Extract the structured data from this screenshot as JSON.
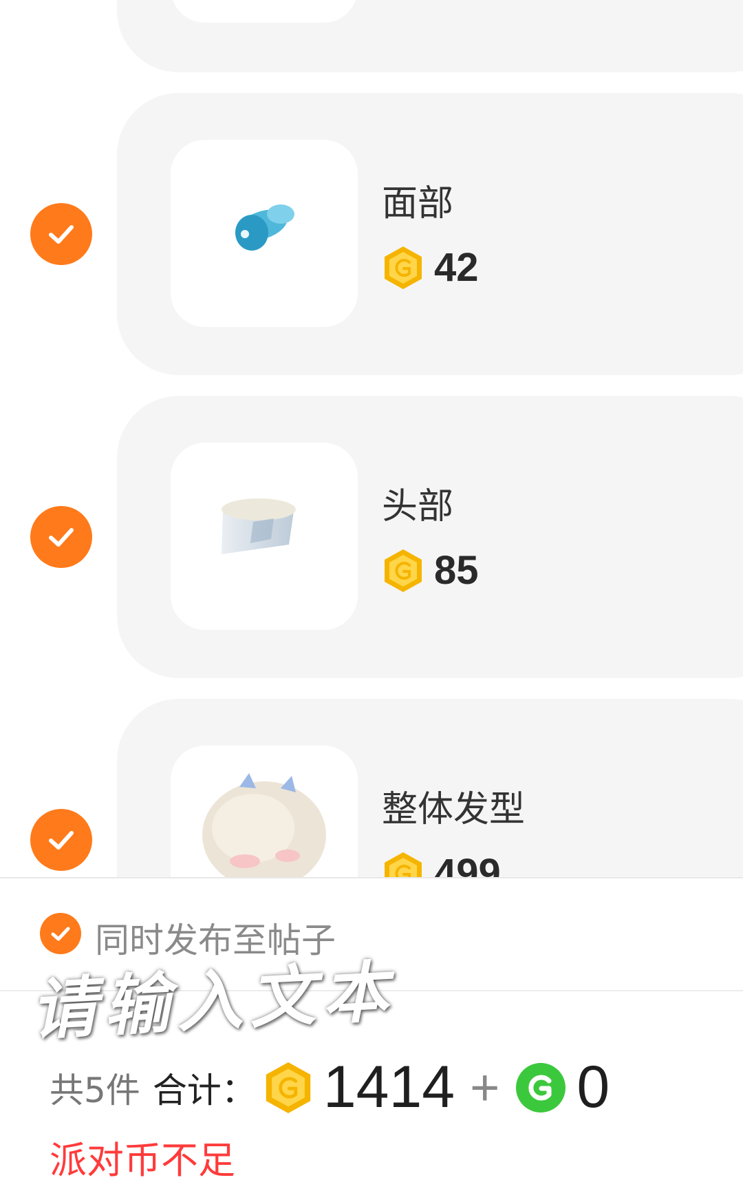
{
  "items": [
    {
      "name": "面部",
      "price": "42",
      "selected": true,
      "image": "blue-pacifier"
    },
    {
      "name": "头部",
      "price": "85",
      "selected": true,
      "image": "paper-cap"
    },
    {
      "name": "整体发型",
      "price": "499",
      "selected": true,
      "image": "twin-tail-hair"
    }
  ],
  "footer": {
    "publish_label": "同时发布至帖子",
    "publish_checked": true,
    "watermark_text": "请输入文本",
    "count_label": "共5件",
    "total_label": "合计：",
    "total_amount": "1414",
    "plus": "+",
    "party_amount": "0",
    "warning": "派对币不足"
  },
  "icons": {
    "check": "check-icon",
    "gold_coin": "gold-coin-icon",
    "green_coin": "green-coin-icon"
  },
  "colors": {
    "accent": "#ff7a1a",
    "card_bg": "#f5f5f5",
    "warning": "#ff3b3b",
    "gold": "#f5b400",
    "green": "#3cc83c"
  }
}
